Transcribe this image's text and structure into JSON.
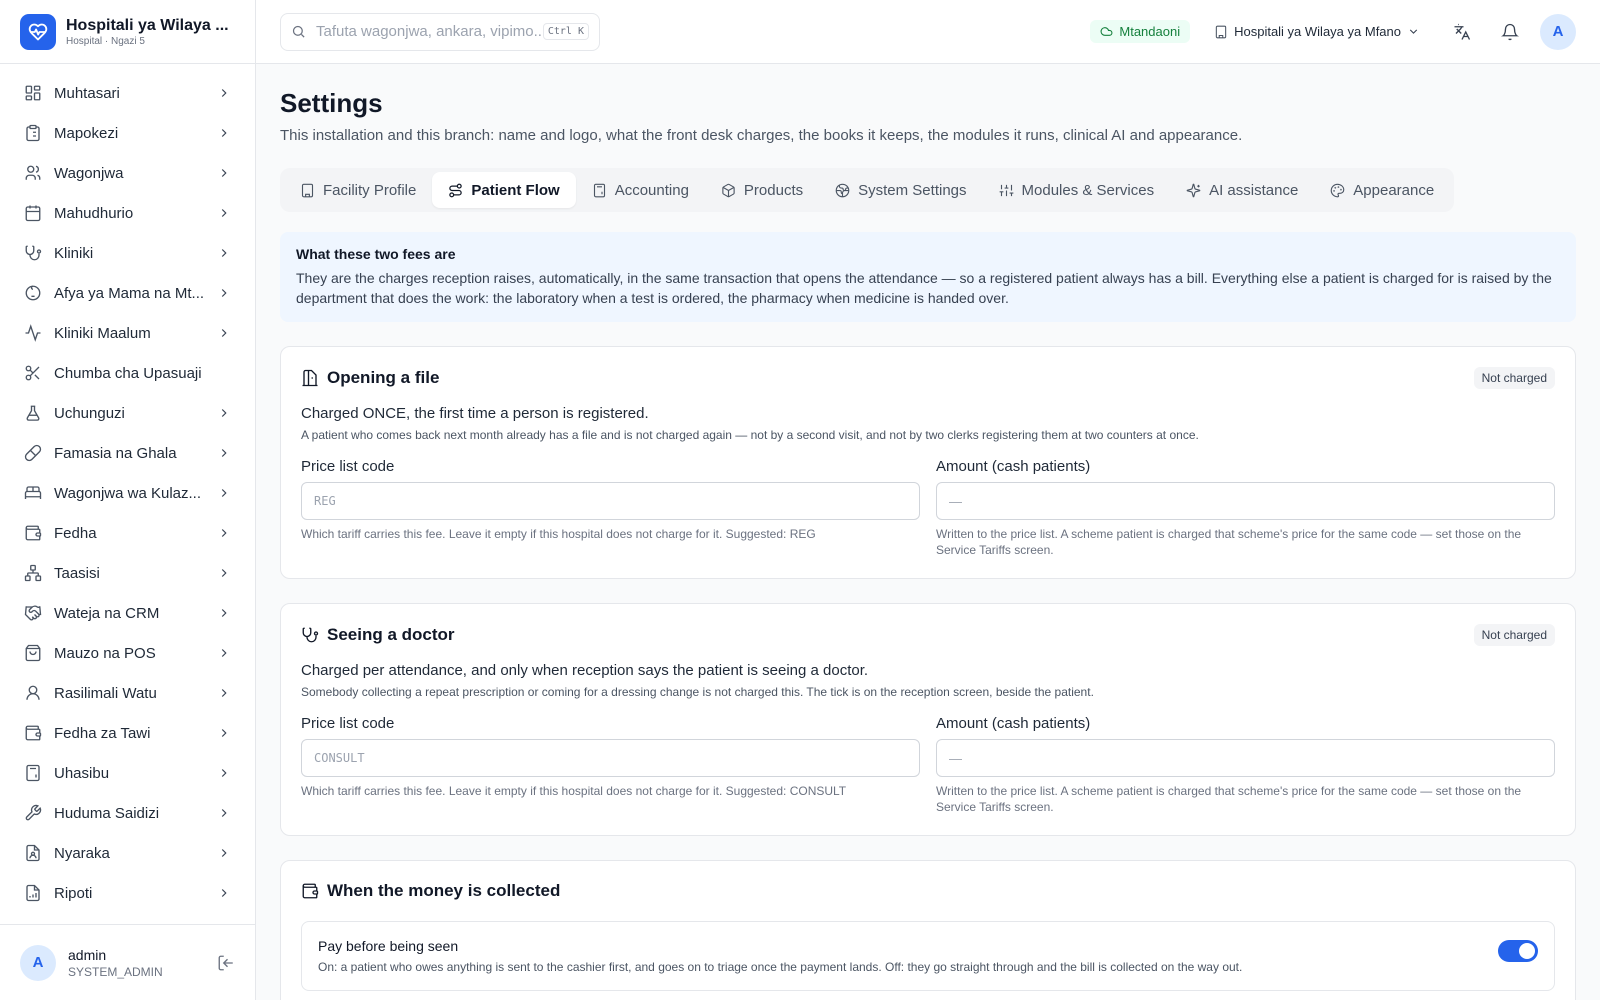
{
  "brand": {
    "title": "Hospitali ya Wilaya ...",
    "subtitle": "Hospital · Ngazi 5",
    "accent": "#2563eb"
  },
  "sidebar": {
    "items": [
      {
        "label": "Muhtasari",
        "icon": "grid-icon",
        "has_children": true
      },
      {
        "label": "Mapokezi",
        "icon": "clipboard-icon",
        "has_children": true
      },
      {
        "label": "Wagonjwa",
        "icon": "users-icon",
        "has_children": true
      },
      {
        "label": "Mahudhurio",
        "icon": "calendar-icon",
        "has_children": true
      },
      {
        "label": "Kliniki",
        "icon": "stethoscope-icon",
        "has_children": true
      },
      {
        "label": "Afya ya Mama na Mt...",
        "icon": "baby-icon",
        "has_children": true
      },
      {
        "label": "Kliniki Maalum",
        "icon": "activity-icon",
        "has_children": true
      },
      {
        "label": "Chumba cha Upasuaji",
        "icon": "scissors-icon",
        "has_children": false
      },
      {
        "label": "Uchunguzi",
        "icon": "flask-icon",
        "has_children": true
      },
      {
        "label": "Famasia na Ghala",
        "icon": "pill-icon",
        "has_children": true
      },
      {
        "label": "Wagonjwa wa Kulaz...",
        "icon": "bed-icon",
        "has_children": true
      },
      {
        "label": "Fedha",
        "icon": "wallet-icon",
        "has_children": true
      },
      {
        "label": "Taasisi",
        "icon": "network-icon",
        "has_children": true
      },
      {
        "label": "Wateja na CRM",
        "icon": "handshake-icon",
        "has_children": true
      },
      {
        "label": "Mauzo na POS",
        "icon": "shopping-bag-icon",
        "has_children": true
      },
      {
        "label": "Rasilimali Watu",
        "icon": "user-icon",
        "has_children": true
      },
      {
        "label": "Fedha za Tawi",
        "icon": "wallet-icon",
        "has_children": true
      },
      {
        "label": "Uhasibu",
        "icon": "calculator-icon",
        "has_children": true
      },
      {
        "label": "Huduma Saidizi",
        "icon": "wrench-icon",
        "has_children": true
      },
      {
        "label": "Nyaraka",
        "icon": "file-user-icon",
        "has_children": true
      },
      {
        "label": "Ripoti",
        "icon": "file-chart-icon",
        "has_children": true
      }
    ]
  },
  "user": {
    "initial": "A",
    "name": "admin",
    "role": "SYSTEM_ADMIN"
  },
  "topbar": {
    "search_placeholder": "Tafuta wagonjwa, ankara, vipimo...",
    "shortcut": "Ctrl K",
    "status": "Mtandaoni",
    "branch": "Hospitali ya Wilaya ya Mfano",
    "avatar_initial": "A"
  },
  "page": {
    "title": "Settings",
    "description": "This installation and this branch: name and logo, what the front desk charges, the books it keeps, the modules it runs, clinical AI and appearance."
  },
  "tabs": [
    {
      "label": "Facility Profile",
      "icon": "building-icon",
      "active": false
    },
    {
      "label": "Patient Flow",
      "icon": "route-icon",
      "active": true
    },
    {
      "label": "Accounting",
      "icon": "calculator-icon",
      "active": false
    },
    {
      "label": "Products",
      "icon": "box-icon",
      "active": false
    },
    {
      "label": "System Settings",
      "icon": "globe-icon",
      "active": false
    },
    {
      "label": "Modules & Services",
      "icon": "sliders-icon",
      "active": false
    },
    {
      "label": "AI assistance",
      "icon": "sparkles-icon",
      "active": false
    },
    {
      "label": "Appearance",
      "icon": "palette-icon",
      "active": false
    }
  ],
  "info": {
    "title": "What these two fees are",
    "body": "They are the charges reception raises, automatically, in the same transaction that opens the attendance — so a registered patient always has a bill. Everything else a patient is charged for is raised by the department that does the work: the laboratory when a test is ordered, the pharmacy when medicine is handed over."
  },
  "fees": [
    {
      "title": "Opening a file",
      "icon": "file-cabinet-icon",
      "badge": "Not charged",
      "lead": "Charged ONCE, the first time a person is registered.",
      "note": "A patient who comes back next month already has a file and is not charged again — not by a second visit, and not by two clerks registering them at two counters at once.",
      "code_label": "Price list code",
      "code_placeholder": "REG",
      "code_help": "Which tariff carries this fee. Leave it empty if this hospital does not charge for it. Suggested: REG",
      "amount_label": "Amount (cash patients)",
      "amount_placeholder": "—",
      "amount_help": "Written to the price list. A scheme patient is charged that scheme's price for the same code — set those on the Service Tariffs screen."
    },
    {
      "title": "Seeing a doctor",
      "icon": "stethoscope-icon",
      "badge": "Not charged",
      "lead": "Charged per attendance, and only when reception says the patient is seeing a doctor.",
      "note": "Somebody collecting a repeat prescription or coming for a dressing change is not charged this. The tick is on the reception screen, beside the patient.",
      "code_label": "Price list code",
      "code_placeholder": "CONSULT",
      "code_help": "Which tariff carries this fee. Leave it empty if this hospital does not charge for it. Suggested: CONSULT",
      "amount_label": "Amount (cash patients)",
      "amount_placeholder": "—",
      "amount_help": "Written to the price list. A scheme patient is charged that scheme's price for the same code — set those on the Service Tariffs screen."
    }
  ],
  "collection": {
    "title": "When the money is collected",
    "icon": "wallet-icon",
    "toggle_label": "Pay before being seen",
    "toggle_desc": "On: a patient who owes anything is sent to the cashier first, and goes on to triage once the payment lands. Off: they go straight through and the bill is collected on the way out.",
    "toggle_on": true
  }
}
